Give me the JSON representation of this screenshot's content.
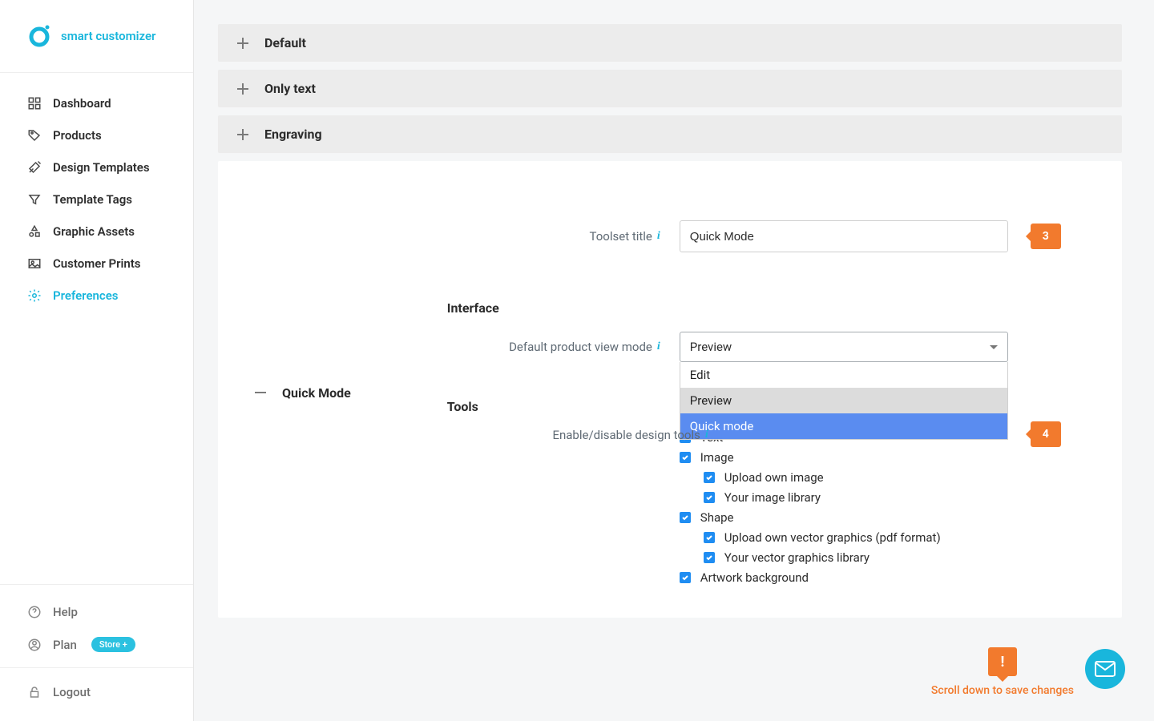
{
  "brand": {
    "name": "smart customizer"
  },
  "sidebar": {
    "items": [
      {
        "label": "Dashboard"
      },
      {
        "label": "Products"
      },
      {
        "label": "Design Templates"
      },
      {
        "label": "Template Tags"
      },
      {
        "label": "Graphic Assets"
      },
      {
        "label": "Customer Prints"
      },
      {
        "label": "Preferences"
      }
    ],
    "footer": {
      "help": "Help",
      "plan": "Plan",
      "plan_badge": "Store +",
      "logout": "Logout"
    }
  },
  "accordions": {
    "default": "Default",
    "only_text": "Only text",
    "engraving": "Engraving",
    "quick_mode": "Quick Mode"
  },
  "form": {
    "toolset_title_label": "Toolset title",
    "toolset_title_value": "Quick Mode",
    "interface_heading": "Interface",
    "view_mode_label": "Default product view mode",
    "view_mode_value": "Preview",
    "view_mode_options": {
      "edit": "Edit",
      "preview": "Preview",
      "quick": "Quick mode"
    },
    "tools_heading": "Tools",
    "enable_tools_label": "Enable/disable design tools",
    "checks": {
      "text": "Text",
      "image": "Image",
      "upload_own_image": "Upload own image",
      "your_image_library": "Your image library",
      "shape": "Shape",
      "upload_own_vector": "Upload own vector graphics (pdf format)",
      "your_vector_library": "Your vector graphics library",
      "artwork_bg": "Artwork background"
    }
  },
  "callouts": {
    "three": "3",
    "four": "4"
  },
  "toast": {
    "text": "Scroll down to save changes",
    "bang": "!"
  },
  "icons": {
    "info": "i"
  }
}
